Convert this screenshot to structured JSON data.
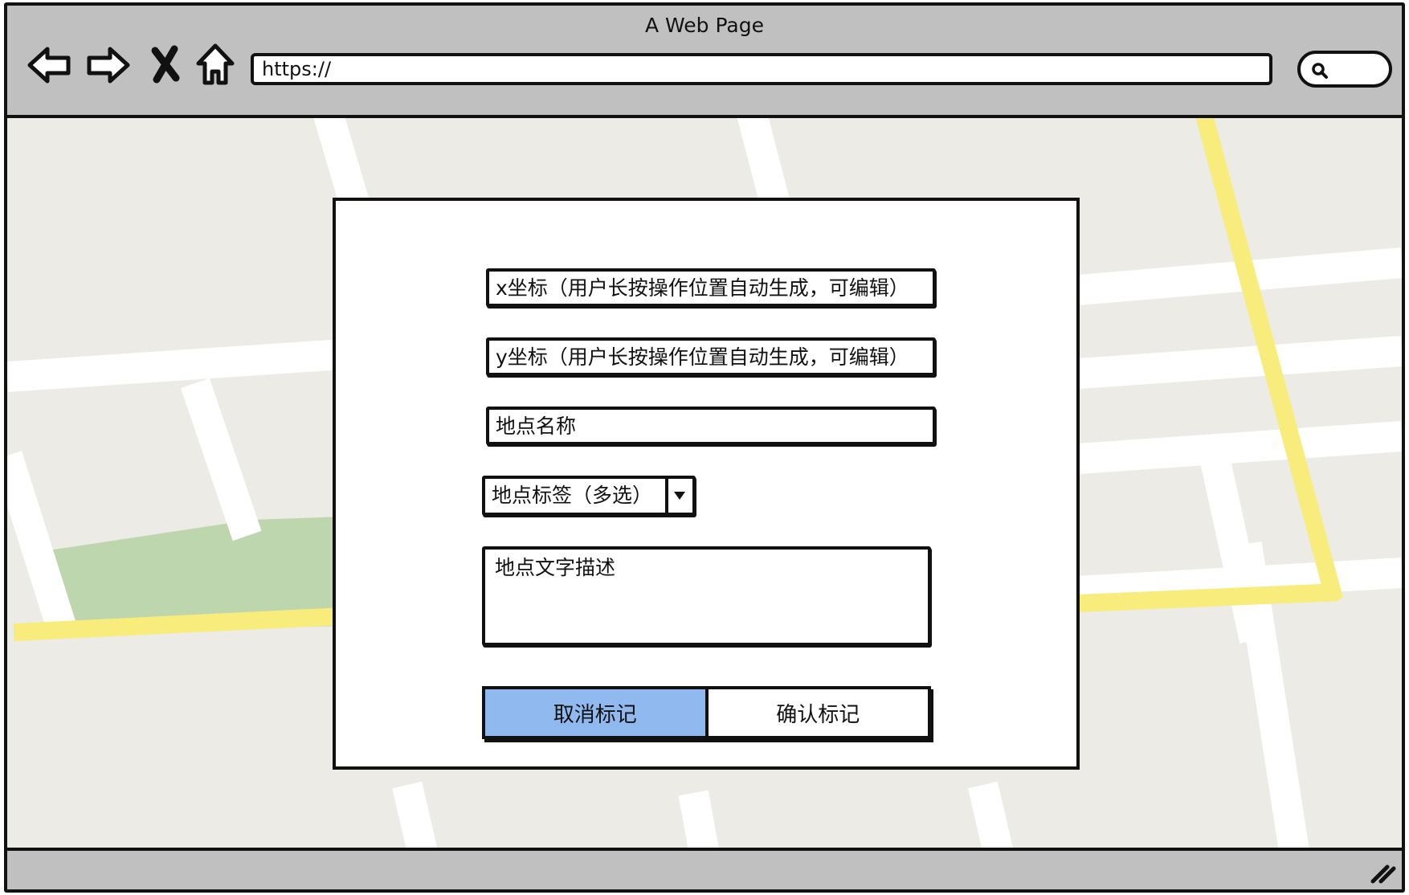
{
  "window": {
    "title": "A Web Page",
    "url": "https://"
  },
  "icons": {
    "back": "arrow-left-icon",
    "forward": "arrow-right-icon",
    "stop": "close-icon",
    "home": "home-icon",
    "search": "search-icon",
    "resize": "resize-grip-icon",
    "dropdown": "chevron-down-icon"
  },
  "form": {
    "x_coord_placeholder": "x坐标（用户长按操作位置自动生成，可编辑）",
    "y_coord_placeholder": "y坐标（用户长按操作位置自动生成，可编辑）",
    "place_name_placeholder": "地点名称",
    "tags_select_label": "地点标签（多选）",
    "description_placeholder": "地点文字描述",
    "cancel_label": "取消标记",
    "confirm_label": "确认标记"
  },
  "colors": {
    "chrome": "#c0c0c0",
    "map_land": "#ecebe5",
    "map_road": "#ffffff",
    "map_major_road": "#f7ec7c",
    "map_park": "#bdd6ad",
    "cancel_button": "#90b9f0"
  }
}
